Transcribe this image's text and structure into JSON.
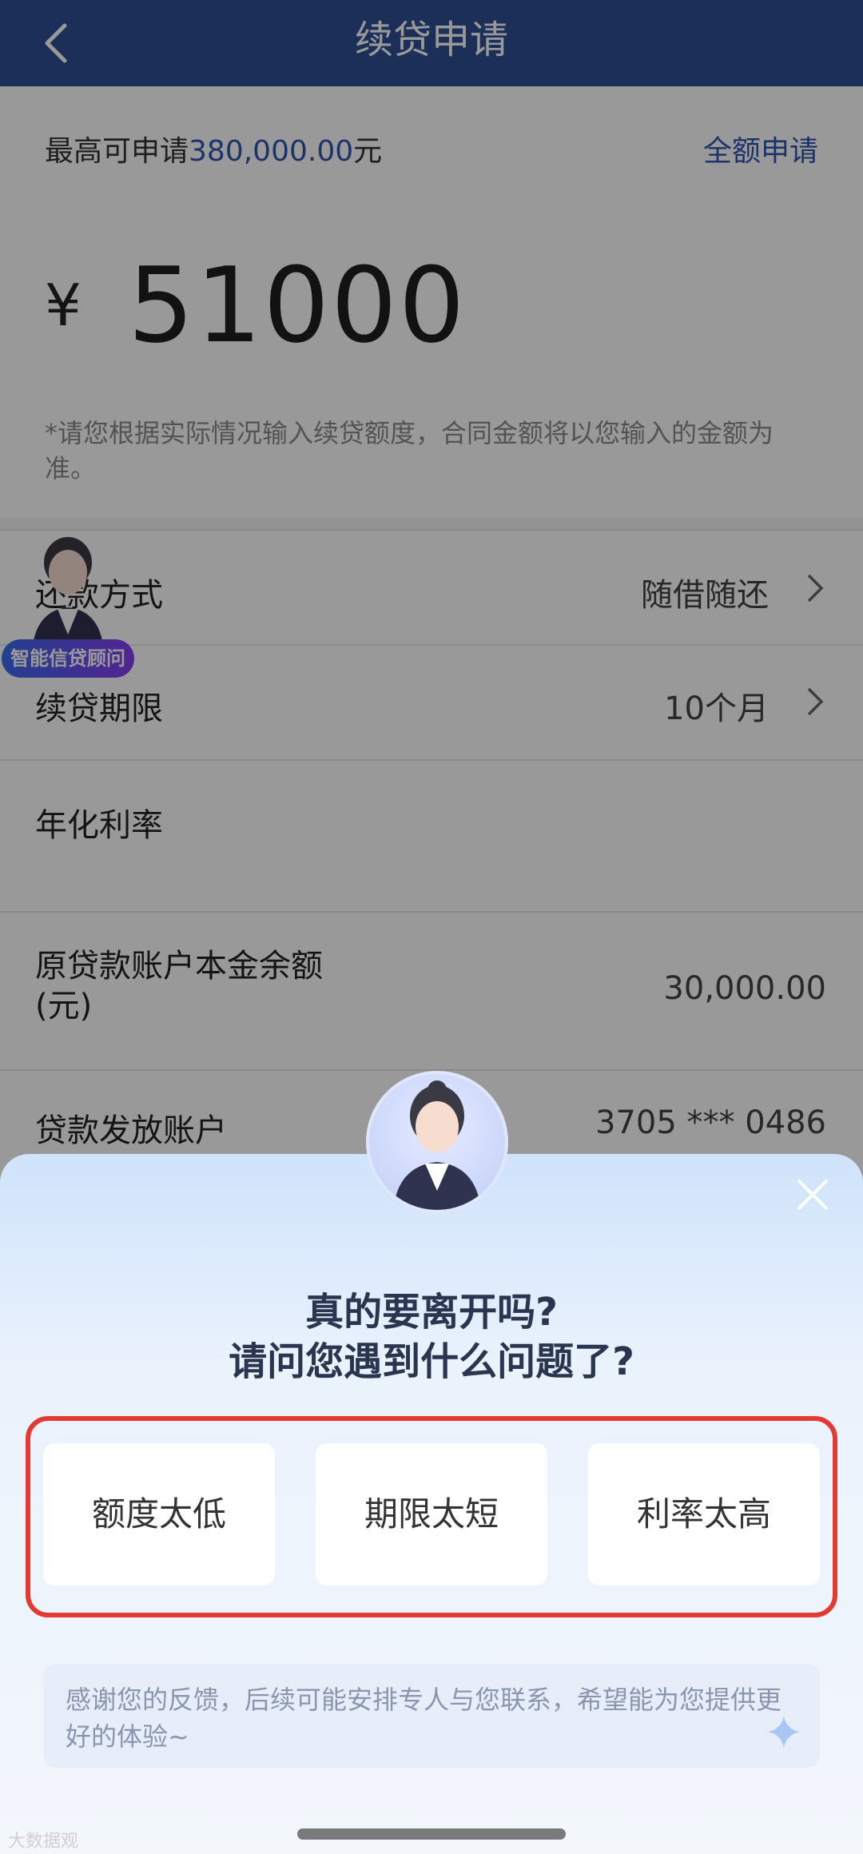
{
  "header": {
    "title": "续贷申请"
  },
  "amount_section": {
    "max_label": "最高可申请",
    "max_value": "380,000.00",
    "max_unit": "元",
    "full_apply": "全额申请",
    "currency": "¥",
    "amount": "51000",
    "note": "*请您根据实际情况输入续贷额度，合同金额将以您输入的金额为准。"
  },
  "rows": {
    "repay": {
      "label": "还款方式",
      "value": "随借随还"
    },
    "term": {
      "label": "续贷期限",
      "value": "10个月"
    },
    "rate": {
      "label": "年化利率"
    },
    "balance": {
      "label": "原贷款账户本金余额",
      "label2": "(元)",
      "value": "30,000.00"
    },
    "account": {
      "label": "贷款发放账户",
      "value": "3705 *** 0486"
    }
  },
  "advisor": {
    "badge": "智能信贷顾问"
  },
  "sheet": {
    "question1": "真的要离开吗?",
    "question2": "请问您遇到什么问题了?",
    "options": [
      "额度太低",
      "期限太短",
      "利率太高"
    ],
    "feedback": "感谢您的反馈，后续可能安排专人与您联系，希望能为您提供更好的体验~"
  },
  "watermark": "大数据观",
  "colors": {
    "header": "#2f4f95",
    "accent": "#2f56b0",
    "highlight_frame": "#e53935"
  },
  "icons": [
    "back-chevron-icon",
    "chevron-right-icon",
    "close-icon",
    "sparkle-icon"
  ]
}
